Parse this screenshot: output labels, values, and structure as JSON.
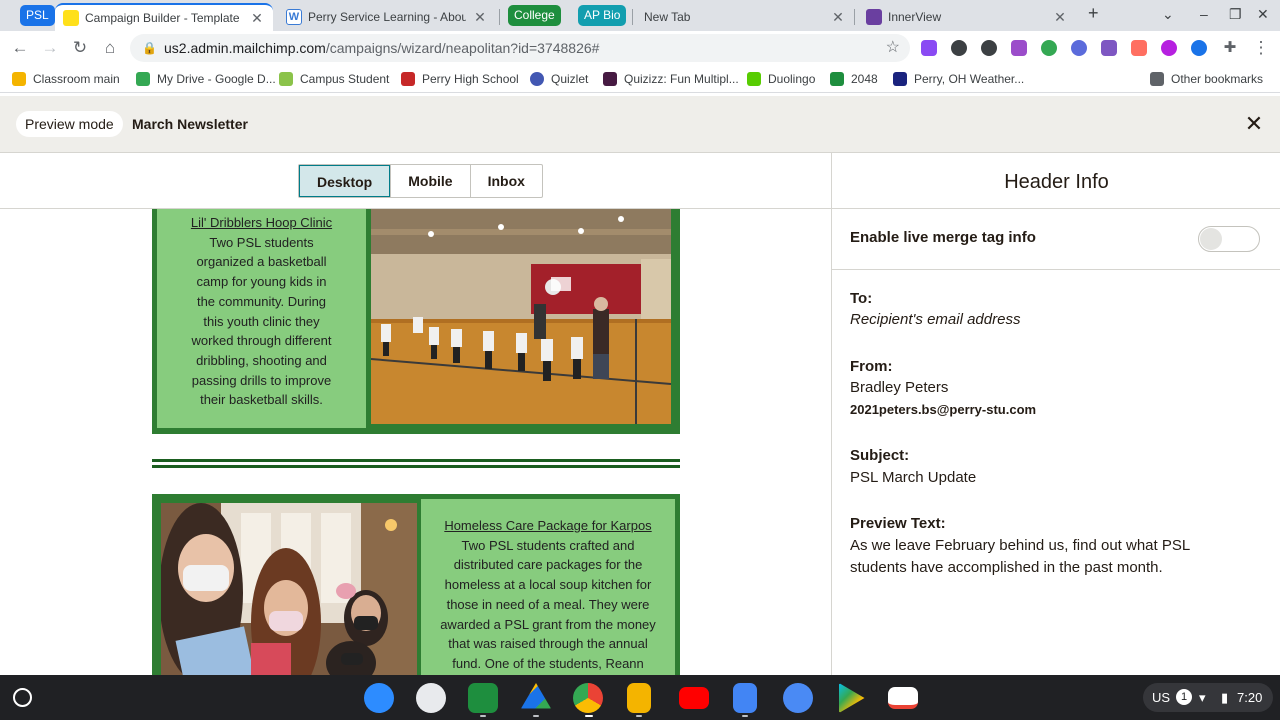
{
  "browser": {
    "tabs": [
      {
        "label": "PSL",
        "kind": "group",
        "color": "#1a73e8"
      },
      {
        "label": "Campaign Builder - Template De",
        "active": true
      },
      {
        "label": "Perry Service Learning - About"
      },
      {
        "label": "College",
        "kind": "group",
        "color": "#1e8e3e"
      },
      {
        "label": "AP Bio",
        "kind": "group",
        "color": "#129eaf"
      },
      {
        "label": "New Tab"
      },
      {
        "label": "InnerView"
      }
    ],
    "new_tab": "+",
    "url_host": "us2.admin.mailchimp.com",
    "url_path": "/campaigns/wizard/neapolitan?id=3748826#",
    "bookmarks": [
      "Classroom main",
      "My Drive - Google D...",
      "Campus Student",
      "Perry High School",
      "Quizlet",
      "Quizizz: Fun Multipl...",
      "Duolingo",
      "2048",
      "Perry, OH Weather..."
    ],
    "other_bookmarks": "Other bookmarks"
  },
  "app": {
    "preview_mode": "Preview mode",
    "campaign_name": "March Newsletter",
    "view_toggle": [
      "Desktop",
      "Mobile",
      "Inbox"
    ],
    "active_view": "Desktop"
  },
  "email": {
    "articles": [
      {
        "title": "Lil' Dribblers Hoop Clinic",
        "lines": [
          "Two PSL students",
          "organized a basketball",
          "camp for young kids in",
          "the community. During",
          "this youth clinic they",
          "worked through different",
          "dribbling, shooting and",
          "passing drills to improve",
          "their basketball skills."
        ]
      },
      {
        "title": "Homeless Care Package for Karpos",
        "lines": [
          "Two PSL students crafted and",
          "distributed care packages for the",
          "homeless at a local soup kitchen for",
          "those in need of a meal. They were",
          "awarded a PSL grant from the money",
          "that was raised through the annual",
          "fund. One of the students, Reann"
        ]
      }
    ]
  },
  "header_info": {
    "title": "Header Info",
    "merge_tag_label": "Enable live merge tag info",
    "merge_tag_enabled": false,
    "to_label": "To:",
    "to_value": "Recipient's email address",
    "from_label": "From:",
    "from_name": "Bradley Peters",
    "from_email": "2021peters.bs@perry-stu.com",
    "subject_label": "Subject:",
    "subject_value": "PSL March Update",
    "preview_label": "Preview Text:",
    "preview_line1": "As we leave February behind us, find out what PSL",
    "preview_line2": "students have accomplished in the past month."
  },
  "shelf": {
    "apps": [
      "zoom-icon",
      "camera-icon",
      "classroom-icon",
      "drive-icon",
      "chrome-icon",
      "slides-icon",
      "youtube-icon",
      "docs-icon",
      "files-icon",
      "play-store-icon",
      "gmail-icon"
    ],
    "tray_region": "US",
    "tray_badge": "1",
    "time": "7:20"
  }
}
